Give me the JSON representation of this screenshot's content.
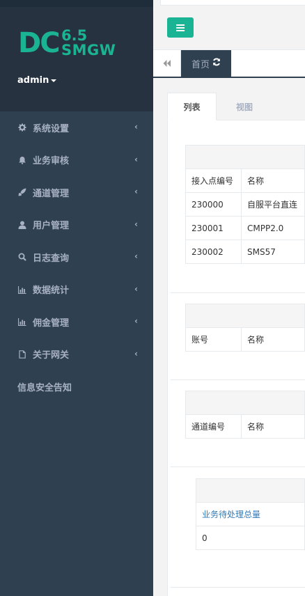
{
  "logo": {
    "dc": "DC",
    "version": "6.5",
    "name": "SMGW"
  },
  "user": {
    "name": "admin"
  },
  "sidebar": {
    "items": [
      {
        "label": "系统设置",
        "icon": "gear-icon"
      },
      {
        "label": "业务审核",
        "icon": "bell-icon"
      },
      {
        "label": "通道管理",
        "icon": "rocket-icon"
      },
      {
        "label": "用户管理",
        "icon": "user-icon"
      },
      {
        "label": "日志查询",
        "icon": "search-icon"
      },
      {
        "label": "数据统计",
        "icon": "bar-chart-icon"
      },
      {
        "label": "佣金管理",
        "icon": "bar-chart-icon"
      },
      {
        "label": "关于网关",
        "icon": "file-icon"
      }
    ],
    "notice": "信息安全告知"
  },
  "tabs": {
    "home_label": "首页"
  },
  "content": {
    "tabs": [
      {
        "label": "列表"
      },
      {
        "label": "视图"
      }
    ],
    "table1": {
      "headers": [
        "接入点编号",
        "名称"
      ],
      "rows": [
        [
          "230000",
          "自服平台直连"
        ],
        [
          "230001",
          "CMPP2.0"
        ],
        [
          "230002",
          "SMS57"
        ]
      ]
    },
    "table2": {
      "headers": [
        "账号",
        "名称"
      ]
    },
    "table3": {
      "headers": [
        "通道编号",
        "名称"
      ]
    },
    "table4": {
      "header": "业务待处理总量",
      "value": "0"
    }
  }
}
